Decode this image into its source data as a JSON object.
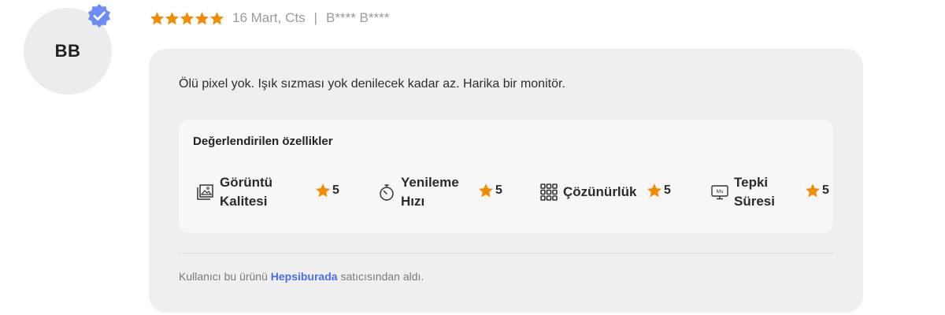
{
  "reviewer": {
    "initials": "BB",
    "verified": true
  },
  "review": {
    "rating": 5,
    "date": "16 Mart, Cts",
    "separator": "|",
    "author": "B**** B****",
    "comment": "Ölü pixel yok. Işık sızması yok denilecek kadar az. Harika bir monitör."
  },
  "features": {
    "title": "Değerlendirilen özellikler",
    "items": [
      {
        "label_line1": "Görüntü",
        "label_line2": "Kalitesi",
        "rating": "5",
        "icon": "image-icon"
      },
      {
        "label_line1": "Yenileme",
        "label_line2": "Hızı",
        "rating": "5",
        "icon": "stopwatch-icon"
      },
      {
        "label_line1": "Çözünürlük",
        "label_line2": "",
        "rating": "5",
        "icon": "grid-icon"
      },
      {
        "label_line1": "Tepki",
        "label_line2": "Süresi",
        "rating": "5",
        "icon": "monitor-ms-icon"
      }
    ]
  },
  "purchase": {
    "prefix": "Kullanıcı bu ürünü ",
    "seller": "Hepsiburada",
    "suffix": " satıcısından aldı."
  },
  "colors": {
    "star": "#f28b00",
    "verified": "#6d8cf7",
    "seller_link": "#4a6cf7",
    "card_bg": "#efefef"
  }
}
